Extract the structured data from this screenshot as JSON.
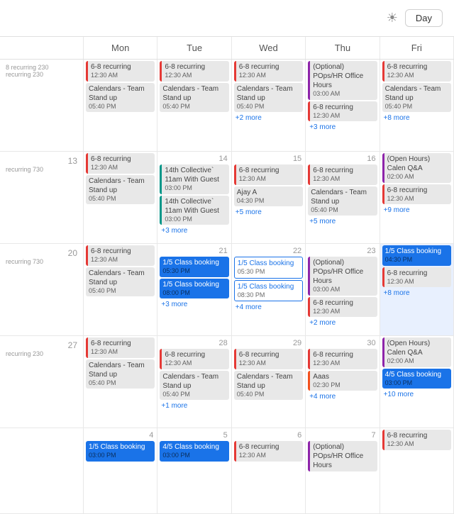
{
  "topbar": {
    "day_label": "Day"
  },
  "headers": [
    "Mon",
    "Tue",
    "Wed",
    "Thu",
    "Fri"
  ],
  "weeks": [
    {
      "week_label": "",
      "days": [
        {
          "date": "",
          "events": [
            {
              "type": "red-left",
              "title": "6-8 recurring",
              "time": "12:30 AM"
            },
            {
              "type": "gray",
              "title": "Calendars - Team Stand up",
              "time": "05:40 PM"
            }
          ],
          "more": ""
        },
        {
          "date": "",
          "events": [
            {
              "type": "red-left",
              "title": "6-8 recurring",
              "time": "12:30 AM"
            },
            {
              "type": "gray",
              "title": "Calendars - Team Stand up",
              "time": "05:40 PM"
            }
          ],
          "more": ""
        },
        {
          "date": "",
          "events": [
            {
              "type": "red-left",
              "title": "6-8 recurring",
              "time": "12:30 AM"
            },
            {
              "type": "gray",
              "title": "Calendars - Team Stand up",
              "time": "05:40 PM"
            }
          ],
          "more": "+2 more"
        },
        {
          "date": "",
          "events": [
            {
              "type": "purple-left",
              "title": "(Optional) POps/HR Office Hours",
              "time": "03:00 AM"
            },
            {
              "type": "red-left",
              "title": "6-8 recurring",
              "time": "12:30 AM"
            }
          ],
          "more": "+3 more"
        },
        {
          "date": "",
          "events": [
            {
              "type": "red-left",
              "title": "6-8 recurring",
              "time": "12:30 AM"
            },
            {
              "type": "gray",
              "title": "Calendars - Team Stand up",
              "time": "05:40 PM"
            }
          ],
          "more": "+8 more"
        }
      ]
    },
    {
      "week_label": "13",
      "days": [
        {
          "date": "",
          "events": [
            {
              "type": "red-left",
              "title": "6-8 recurring",
              "time": "12:30 AM"
            },
            {
              "type": "gray",
              "title": "Calendars - Team Stand up",
              "time": "05:40 PM"
            }
          ],
          "more": ""
        },
        {
          "date": "14",
          "events": [
            {
              "type": "teal-left",
              "title": "14th Collective` 11am With Guest",
              "time": "03:00 PM"
            },
            {
              "type": "teal-left",
              "title": "14th Collective` 11am With Guest",
              "time": "03:00 PM"
            }
          ],
          "more": "+3 more"
        },
        {
          "date": "15",
          "events": [
            {
              "type": "red-left",
              "title": "6-8 recurring",
              "time": "12:30 AM"
            },
            {
              "type": "gray",
              "title": "Ajay A",
              "time": "04:30 PM"
            }
          ],
          "more": "+5 more"
        },
        {
          "date": "16",
          "events": [
            {
              "type": "red-left",
              "title": "6-8 recurring",
              "time": "12:30 AM"
            },
            {
              "type": "gray",
              "title": "Calendars - Team Stand up",
              "time": "05:40 PM"
            }
          ],
          "more": "+5 more"
        },
        {
          "date": "",
          "events": [
            {
              "type": "purple-left",
              "title": "(Open Hours) Calen Q&A",
              "time": "02:00 AM"
            },
            {
              "type": "red-left",
              "title": "6-8 recurring",
              "time": "12:30 AM"
            }
          ],
          "more": "+9 more"
        }
      ]
    },
    {
      "week_label": "20",
      "days": [
        {
          "date": "",
          "events": [
            {
              "type": "red-left",
              "title": "6-8 recurring",
              "time": "12:30 AM"
            },
            {
              "type": "gray",
              "title": "Calendars - Team Stand up",
              "time": "05:40 PM"
            }
          ],
          "more": ""
        },
        {
          "date": "21",
          "events": [
            {
              "type": "blue",
              "title": "1/5 Class booking",
              "time": "05:30 PM"
            },
            {
              "type": "blue",
              "title": "1/5 Class booking",
              "time": "08:00 PM"
            }
          ],
          "more": "+3 more"
        },
        {
          "date": "22",
          "events": [
            {
              "type": "blue-outline",
              "title": "1/5 Class booking",
              "time": "05:30 PM"
            },
            {
              "type": "blue-outline",
              "title": "1/5 Class booking",
              "time": "08:30 PM"
            }
          ],
          "more": "+4 more"
        },
        {
          "date": "23",
          "events": [
            {
              "type": "purple-left",
              "title": "(Optional) POps/HR Office Hours",
              "time": "03:00 AM"
            },
            {
              "type": "red-left",
              "title": "6-8 recurring",
              "time": "12:30 AM"
            }
          ],
          "more": "+2 more"
        },
        {
          "date": "",
          "events": [
            {
              "type": "blue",
              "title": "1/5 Class booking",
              "time": "04:30 PM"
            },
            {
              "type": "red-left",
              "title": "6-8 recurring",
              "time": "12:30 AM"
            }
          ],
          "more": "+8 more",
          "today": true
        }
      ]
    },
    {
      "week_label": "27",
      "days": [
        {
          "date": "",
          "events": [
            {
              "type": "red-left",
              "title": "6-8 recurring",
              "time": "12:30 AM"
            },
            {
              "type": "gray",
              "title": "Calendars - Team Stand up",
              "time": "05:40 PM"
            }
          ],
          "more": ""
        },
        {
          "date": "28",
          "events": [
            {
              "type": "red-left",
              "title": "6-8 recurring",
              "time": "12:30 AM"
            },
            {
              "type": "gray",
              "title": "Calendars - Team Stand up",
              "time": "05:40 PM"
            }
          ],
          "more": "+1 more"
        },
        {
          "date": "29",
          "events": [
            {
              "type": "red-left",
              "title": "6-8 recurring",
              "time": "12:30 AM"
            },
            {
              "type": "gray",
              "title": "Calendars - Team Stand up",
              "time": "05:40 PM"
            }
          ],
          "more": ""
        },
        {
          "date": "30",
          "events": [
            {
              "type": "red-left",
              "title": "6-8 recurring",
              "time": "12:30 AM"
            },
            {
              "type": "orange-left",
              "title": "Aaas",
              "time": "02:30 PM"
            }
          ],
          "more": "+4 more"
        },
        {
          "date": "",
          "events": [
            {
              "type": "purple-left",
              "title": "(Open Hours) Calen Q&A",
              "time": "02:00 AM"
            },
            {
              "type": "blue",
              "title": "4/5 Class booking",
              "time": "03:00 PM"
            }
          ],
          "more": "+10 more"
        }
      ]
    },
    {
      "week_label": "",
      "partial": true,
      "days": [
        {
          "date": "4",
          "events": [
            {
              "type": "blue",
              "title": "1/5 Class booking",
              "time": "03:00 PM"
            }
          ],
          "more": ""
        },
        {
          "date": "5",
          "events": [
            {
              "type": "blue",
              "title": "4/5 Class booking",
              "time": "03:00 PM"
            }
          ],
          "more": ""
        },
        {
          "date": "6",
          "events": [
            {
              "type": "red-left",
              "title": "6-8 recurring",
              "time": "12:30 AM"
            }
          ],
          "more": ""
        },
        {
          "date": "7",
          "events": [
            {
              "type": "purple-left",
              "title": "(Optional) POps/HR Office Hours",
              "time": ""
            }
          ],
          "more": ""
        },
        {
          "date": "",
          "events": [
            {
              "type": "red-left",
              "title": "6-8 recurring",
              "time": "12:30 AM"
            }
          ],
          "more": ""
        }
      ]
    }
  ]
}
